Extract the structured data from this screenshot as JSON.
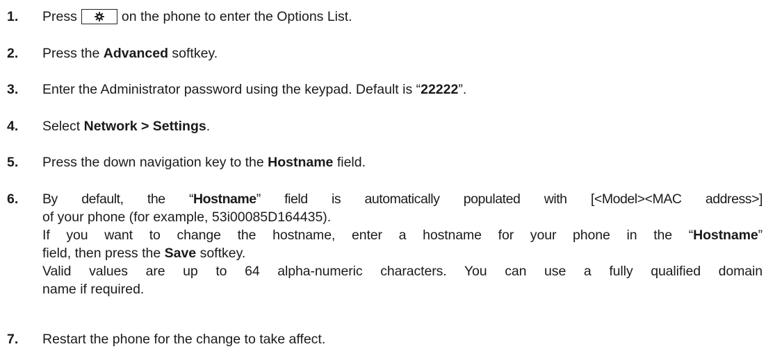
{
  "steps": [
    {
      "number": "1.",
      "prefix": "Press",
      "suffix": "on the phone to enter the Options List.",
      "key_icon": "gear-icon"
    },
    {
      "number": "2.",
      "t1": "Press the ",
      "b1": "Advanced",
      "t2": " softkey."
    },
    {
      "number": "3.",
      "t1": "Enter the Administrator password using the keypad. Default is “",
      "b1": "22222",
      "t2": "”."
    },
    {
      "number": "4.",
      "t1": "Select ",
      "b1": "Network > Settings",
      "t2": "."
    },
    {
      "number": "5.",
      "t1": "Press the down navigation key to the ",
      "b1": "Hostname",
      "t2": " field."
    },
    {
      "number": "6.",
      "p1_t1": "By default, the “",
      "p1_b1": "Hostname",
      "p1_t2": "” field is automatically populated with [<Model><MAC address>]",
      "p1_line2": "of your phone (for example, 53i00085D164435).",
      "p2_t1": "If you want to change the hostname, enter a hostname for your phone in the “",
      "p2_b1": "Hostname",
      "p2_t2": "”",
      "p2_line2_t1": "field, then press the ",
      "p2_line2_b1": "Save",
      "p2_line2_t2": " softkey.",
      "p3_line1": "Valid values are up to 64 alpha-numeric characters. You can use a fully qualified domain",
      "p3_line2": "name if required."
    },
    {
      "number": "7.",
      "t1": "Restart the phone for the change to take affect."
    }
  ]
}
